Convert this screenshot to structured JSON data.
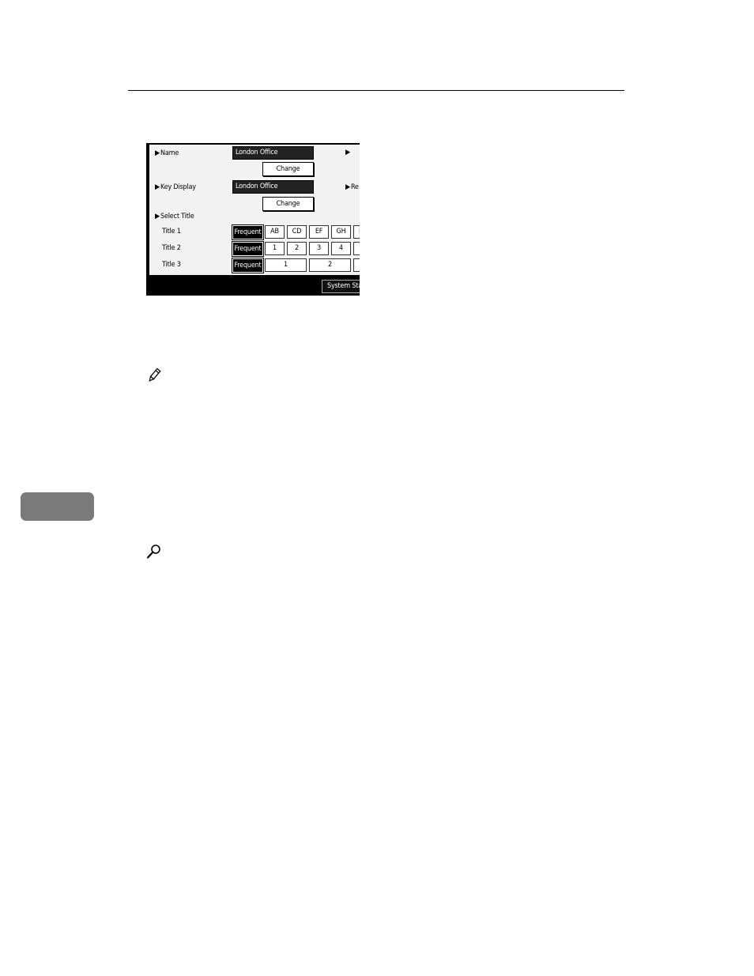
{
  "panel": {
    "name_label": "Name",
    "name_value": "London Office",
    "change_label": "Change",
    "key_display_label": "Key Display",
    "key_display_value": "London Office",
    "right_label_2": "Re",
    "select_title_label": "Select Title",
    "titles": [
      {
        "label": "Title 1",
        "frequent": "Frequent",
        "keys": [
          "AB",
          "CD",
          "EF",
          "GH",
          "I"
        ]
      },
      {
        "label": "Title 2",
        "frequent": "Frequent",
        "keys": [
          "1",
          "2",
          "3",
          "4",
          ""
        ]
      },
      {
        "label": "Title 3",
        "frequent": "Frequent",
        "keys": [
          "1",
          "2",
          ""
        ]
      }
    ],
    "system_status": "System Status"
  },
  "icons": {
    "note": "pencil-icon",
    "reference": "magnifier-icon"
  }
}
